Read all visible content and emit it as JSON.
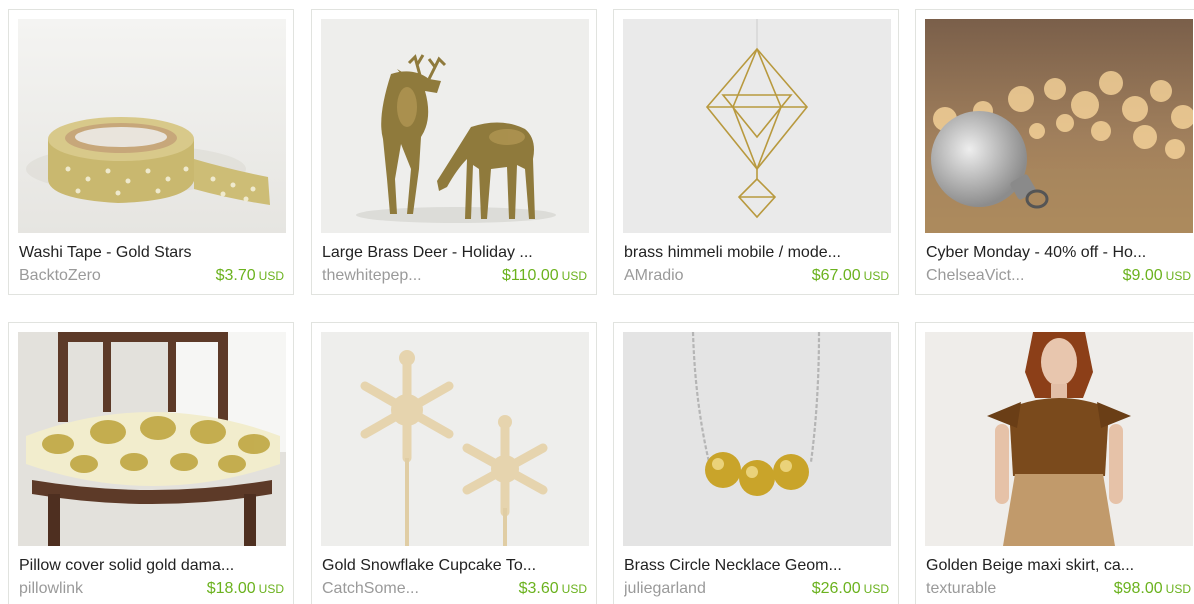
{
  "listings": [
    {
      "title": "Washi Tape - Gold Stars",
      "shop": "BacktoZero",
      "price": "$3.70",
      "currency": "USD",
      "image_icon": "washi-tape-image"
    },
    {
      "title": "Large Brass Deer - Holiday ...",
      "shop": "thewhitepep...",
      "price": "$110.00",
      "currency": "USD",
      "image_icon": "brass-deer-image"
    },
    {
      "title": "brass himmeli mobile / mode...",
      "shop": "AMradio",
      "price": "$67.00",
      "currency": "USD",
      "image_icon": "himmeli-mobile-image"
    },
    {
      "title": "Cyber Monday - 40% off - Ho...",
      "shop": "ChelseaVict...",
      "price": "$9.00",
      "currency": "USD",
      "image_icon": "glitter-ornament-image"
    },
    {
      "title": "Pillow cover solid gold dama...",
      "shop": "pillowlink",
      "price": "$18.00",
      "currency": "USD",
      "image_icon": "damask-pillow-image"
    },
    {
      "title": "Gold Snowflake Cupcake To...",
      "shop": "CatchSome...",
      "price": "$3.60",
      "currency": "USD",
      "image_icon": "snowflake-toppers-image"
    },
    {
      "title": "Brass Circle Necklace Geom...",
      "shop": "juliegarland",
      "price": "$26.00",
      "currency": "USD",
      "image_icon": "brass-necklace-image"
    },
    {
      "title": "Golden Beige maxi skirt, ca...",
      "shop": "texturable",
      "price": "$98.00",
      "currency": "USD",
      "image_icon": "maxi-skirt-image"
    }
  ],
  "colors": {
    "price_green": "#6bb21e",
    "shop_gray": "#9a9a9a",
    "title_dark": "#222222",
    "card_border": "#e1e3df"
  }
}
